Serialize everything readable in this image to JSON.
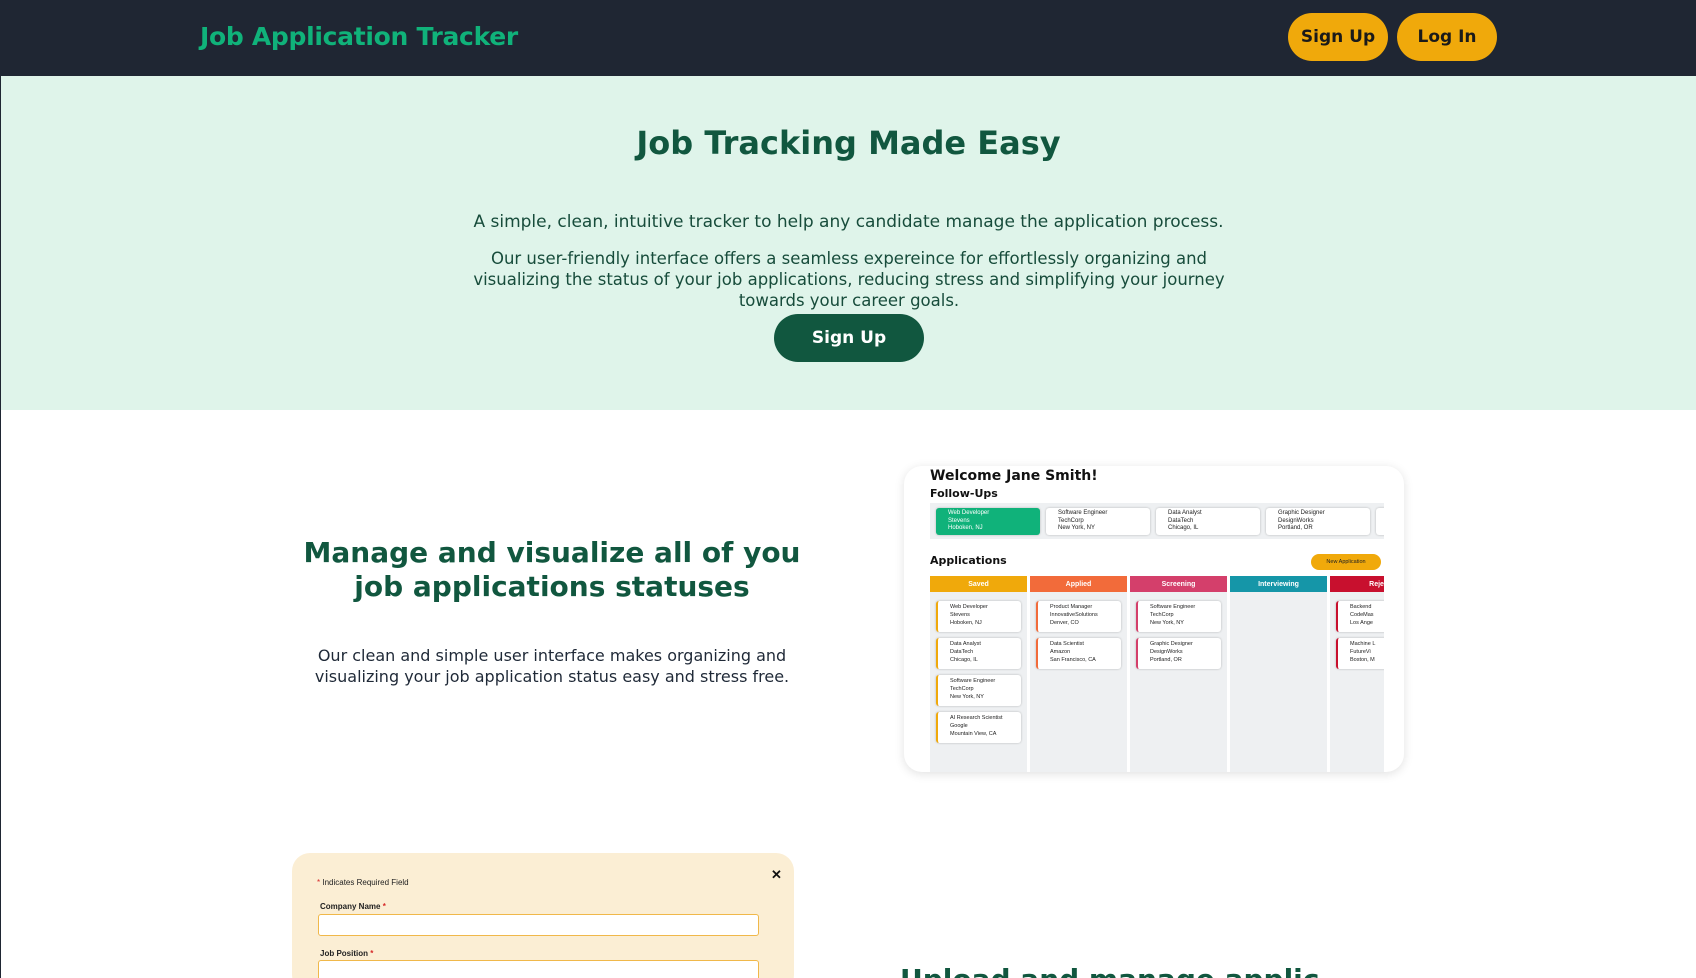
{
  "header": {
    "brand": "Job Application Tracker",
    "signup_label": "Sign Up",
    "login_label": "Log In"
  },
  "hero": {
    "title": "Job Tracking Made Easy",
    "subtitle": "A simple, clean, intuitive tracker to help any candidate manage the application process.",
    "description": "Our user-friendly interface offers a seamless expereince for effortlessly organizing and visualizing the status of your job applications, reducing stress and simplifying your journey towards your career goals.",
    "cta_label": "Sign Up"
  },
  "feature1": {
    "title": "Manage and visualize all of you job applications statuses",
    "text": "Our clean and simple user interface makes organizing and visualizing your job application status easy and stress free."
  },
  "dashboard_preview": {
    "welcome": "Welcome Jane Smith!",
    "followups_title": "Follow-Ups",
    "followups": [
      {
        "title": "Web Developer",
        "company": "Stevens",
        "location": "Hoboken, NJ"
      },
      {
        "title": "Software Engineer",
        "company": "TechCorp",
        "location": "New York, NY"
      },
      {
        "title": "Data Analyst",
        "company": "DataTech",
        "location": "Chicago, IL"
      },
      {
        "title": "Graphic Designer",
        "company": "DesignWorks",
        "location": "Portland, OR"
      }
    ],
    "applications_title": "Applications",
    "new_application_label": "New Application",
    "columns": [
      {
        "name": "Saved",
        "color": "#f0a90b",
        "cards": [
          {
            "title": "Web Developer",
            "company": "Stevens",
            "location": "Hoboken, NJ"
          },
          {
            "title": "Data Analyst",
            "company": "DataTech",
            "location": "Chicago, IL"
          },
          {
            "title": "Software Engineer",
            "company": "TechCorp",
            "location": "New York, NY"
          },
          {
            "title": "AI Research Scientist",
            "company": "Google",
            "location": "Mountain View, CA"
          }
        ]
      },
      {
        "name": "Applied",
        "color": "#f26b3a",
        "cards": [
          {
            "title": "Product Manager",
            "company": "InnovativeSolutions",
            "location": "Denver, CO"
          },
          {
            "title": "Data Scientist",
            "company": "Amazon",
            "location": "San Francisco, CA"
          }
        ]
      },
      {
        "name": "Screening",
        "color": "#d43f6b",
        "cards": [
          {
            "title": "Software Engineer",
            "company": "TechCorp",
            "location": "New York, NY"
          },
          {
            "title": "Graphic Designer",
            "company": "DesignWorks",
            "location": "Portland, OR"
          }
        ]
      },
      {
        "name": "Interviewing",
        "color": "#1596a8",
        "cards": []
      },
      {
        "name": "Rejec",
        "color": "#c8102e",
        "cards": [
          {
            "title": "Backend",
            "company": "CodeMas",
            "location": "Los Ange"
          },
          {
            "title": "Machine L",
            "company": "FutureVi",
            "location": "Boston, M"
          }
        ]
      }
    ]
  },
  "form_preview": {
    "required_note": "Indicates Required Field",
    "close_symbol": "✕",
    "fields": [
      {
        "label": "Company Name"
      },
      {
        "label": "Job Position"
      }
    ]
  },
  "feature2": {
    "title_partial": "Upload and manage applic"
  },
  "colors": {
    "header_bg": "#1f2633",
    "brand_green": "#10b27a",
    "accent_yellow": "#f0a90b",
    "dark_green": "#11573f",
    "hero_bg": "#dff4ea"
  }
}
